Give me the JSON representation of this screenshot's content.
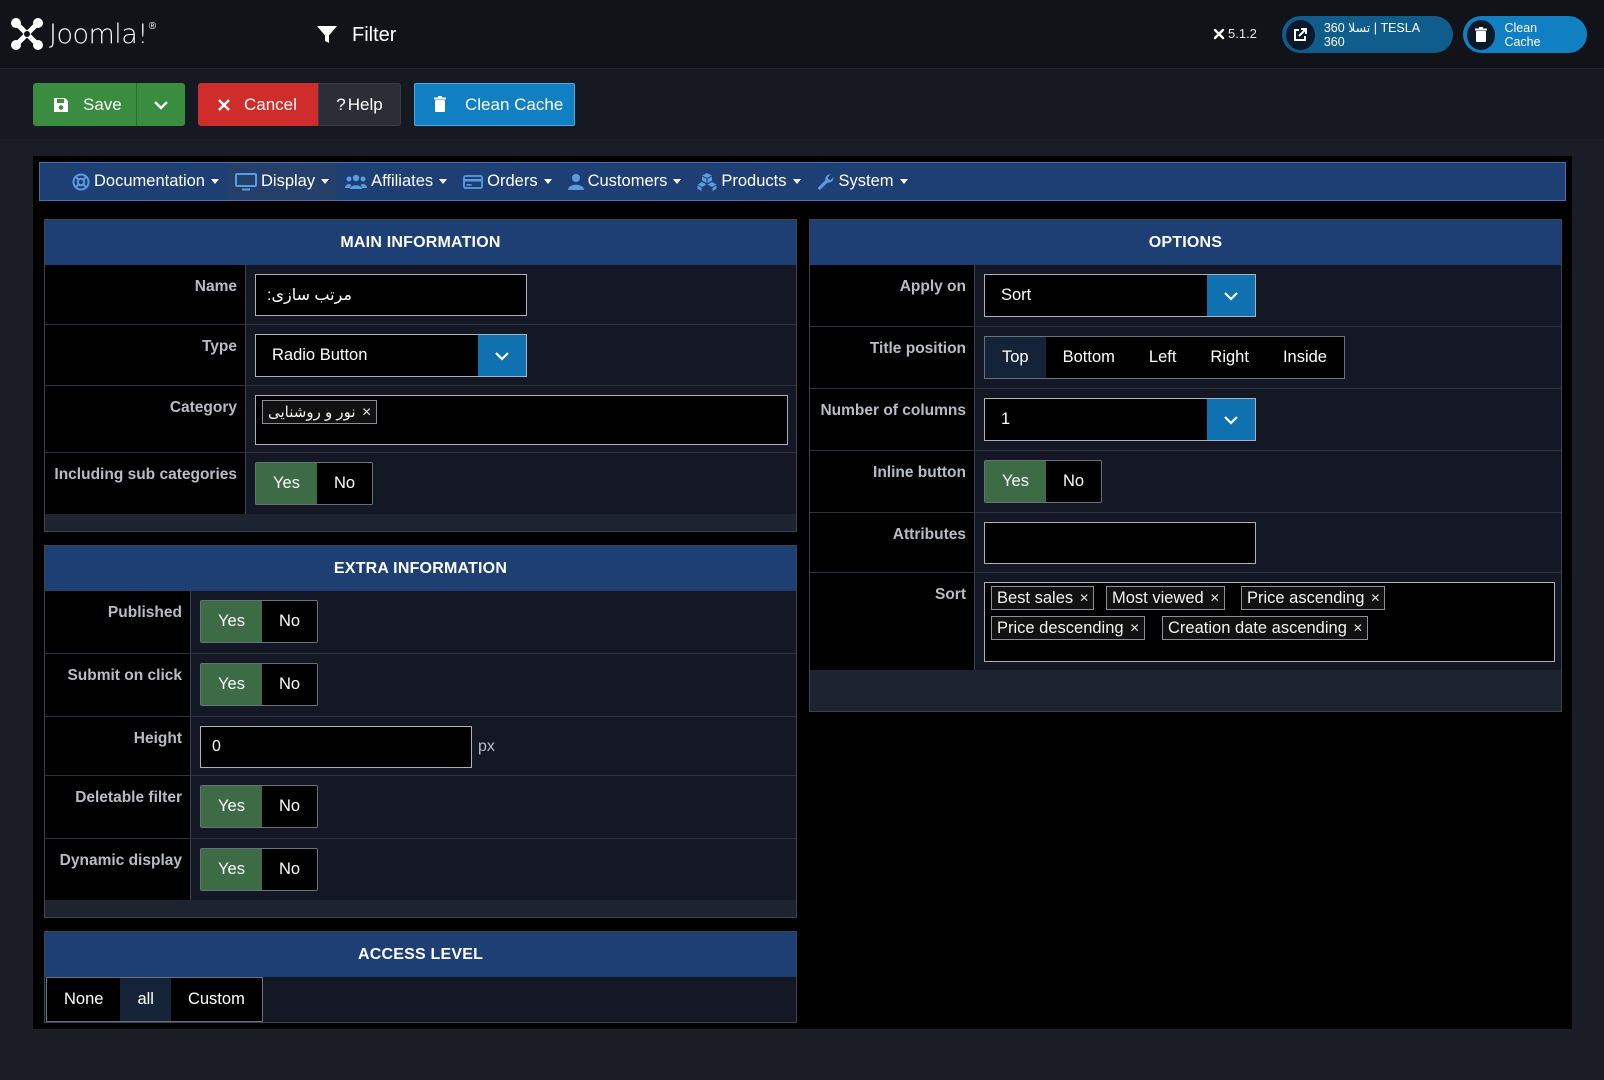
{
  "header": {
    "logo_text": "Joomla!",
    "logo_reg": "®",
    "page_title": "Filter",
    "version": "5.1.2",
    "site_button": "360 تسلا | TESLA 360",
    "clean_cache_button": "Clean Cache"
  },
  "toolbar": {
    "save": "Save",
    "cancel": "Cancel",
    "help": "Help",
    "clean_cache": "Clean Cache"
  },
  "nav": {
    "items": [
      {
        "label": "Documentation",
        "icon": "lifebuoy-icon"
      },
      {
        "label": "Display",
        "icon": "monitor-icon"
      },
      {
        "label": "Affiliates",
        "icon": "users-icon"
      },
      {
        "label": "Orders",
        "icon": "credit-card-icon"
      },
      {
        "label": "Customers",
        "icon": "user-icon"
      },
      {
        "label": "Products",
        "icon": "cubes-icon"
      },
      {
        "label": "System",
        "icon": "wrench-icon"
      }
    ]
  },
  "main_info": {
    "title": "MAIN INFORMATION",
    "name_label": "Name",
    "name_value": "مرتب سازی:",
    "type_label": "Type",
    "type_value": "Radio Button",
    "category_label": "Category",
    "category_tags": [
      "نور و روشنایی"
    ],
    "sub_label": "Including sub categories",
    "yes": "Yes",
    "no": "No"
  },
  "extra_info": {
    "title": "EXTRA INFORMATION",
    "published_label": "Published",
    "submit_label": "Submit on click",
    "height_label": "Height",
    "height_value": "0",
    "height_unit": "px",
    "deletable_label": "Deletable filter",
    "dynamic_label": "Dynamic display",
    "yes": "Yes",
    "no": "No"
  },
  "access": {
    "title": "ACCESS LEVEL",
    "options": [
      "None",
      "all",
      "Custom"
    ],
    "selected": "all"
  },
  "options": {
    "title": "OPTIONS",
    "apply_on_label": "Apply on",
    "apply_on_value": "Sort",
    "title_position_label": "Title position",
    "title_positions": [
      "Top",
      "Bottom",
      "Left",
      "Right",
      "Inside"
    ],
    "title_position_selected": "Top",
    "columns_label": "Number of columns",
    "columns_value": "1",
    "inline_label": "Inline button",
    "attributes_label": "Attributes",
    "sort_label": "Sort",
    "sort_tags": [
      "Best sales",
      "Most viewed",
      "Price ascending",
      "Price descending",
      "Creation date ascending"
    ],
    "yes": "Yes",
    "no": "No"
  },
  "colors": {
    "nav_blue": "#1d3f74",
    "save_green": "#3a8c3f",
    "cancel_red": "#cf2c2c",
    "action_blue": "#1180c2",
    "toggle_on": "#3d6b46"
  }
}
